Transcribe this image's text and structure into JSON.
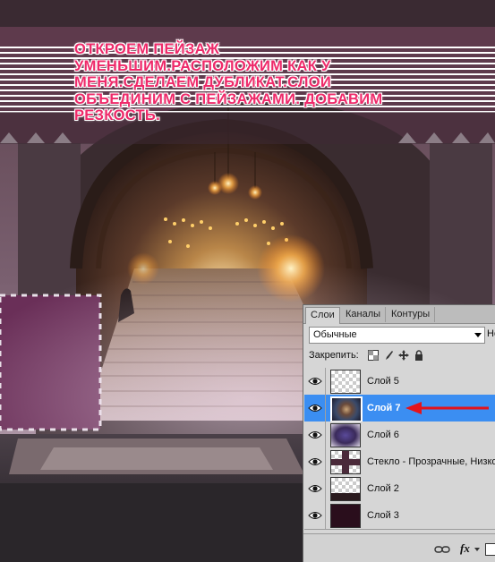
{
  "caption": {
    "lines": "ОТКРОЕМ ПЕЙЗАЖ\nУМЕНЬШИМ.РАСПОЛОЖИМ КАК У\nМЕНЯ.СДЕЛАЕМ ДУБЛИКАТ.СЛОИ\nОБЪЕДИНИМ С ПЕЙЗАЖАМИ. ДОБАВИМ\nРЕЗКОСТЬ."
  },
  "layers_panel": {
    "tabs": [
      "Слои",
      "Каналы",
      "Контуры"
    ],
    "active_tab": "Слои",
    "blend_mode": "Обычные",
    "opacity_label_partial": "Не",
    "lock_label": "Закрепить:",
    "layers": [
      {
        "name": "Слой 5",
        "selected": false,
        "visible": true,
        "thumb": "transparent"
      },
      {
        "name": "Слой 7",
        "selected": true,
        "visible": true,
        "thumb": "eye-image"
      },
      {
        "name": "Слой 6",
        "selected": false,
        "visible": true,
        "thumb": "purple-blur"
      },
      {
        "name": "Стекло - Прозрачные, Низкое",
        "selected": false,
        "visible": true,
        "thumb": "cross-frame"
      },
      {
        "name": "Слой 2",
        "selected": false,
        "visible": true,
        "thumb": "transparent"
      },
      {
        "name": "Слой 3",
        "selected": false,
        "visible": true,
        "thumb": "dark-purple"
      }
    ],
    "footer_icons": [
      "link-icon",
      "fx-icon"
    ],
    "footer_fx_label": "fx"
  },
  "colors": {
    "caption": "#ee2a6a",
    "selection": "#3b8ef2",
    "arrow": "#e3131b"
  }
}
